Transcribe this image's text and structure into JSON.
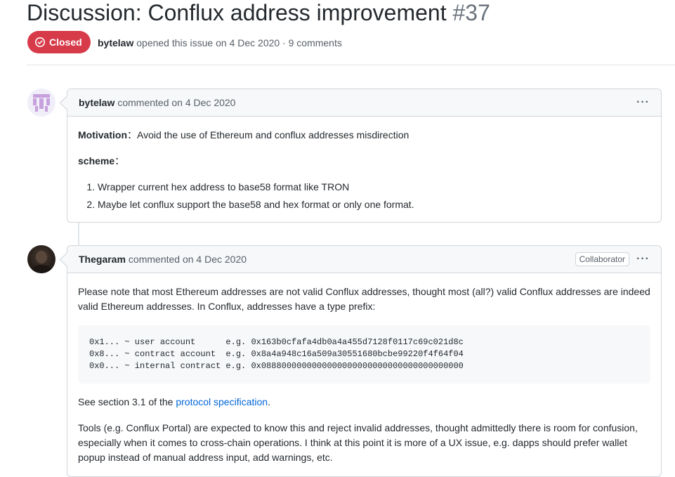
{
  "issue": {
    "title": "Discussion: Conflux address improvement",
    "number": "#37",
    "state": "Closed",
    "state_color": "#d73a49",
    "author": "bytelaw",
    "meta_text": "opened this issue on 4 Dec 2020 · 9 comments"
  },
  "comments": [
    {
      "author": "bytelaw",
      "when": "commented on 4 Dec 2020",
      "avatar_icon": "identicon-avatar",
      "motivation_label": "Motivation",
      "motivation_text": "：Avoid the use of Ethereum and conflux addresses misdirection",
      "scheme_label": "scheme",
      "scheme_suffix": "：",
      "list": [
        "Wrapper current hex address to base58 format like TRON",
        "Maybe let conflux support the base58 and hex format or only one format."
      ],
      "menu_icon": "kebab-menu-icon"
    },
    {
      "author": "Thegaram",
      "when": "commented on 4 Dec 2020",
      "badge": "Collaborator",
      "avatar_icon": "user-photo-avatar",
      "para1": "Please note that most Ethereum addresses are not valid Conflux addresses, thought most (all?) valid Conflux addresses are indeed valid Ethereum addresses. In Conflux, addresses have a type prefix:",
      "code_lines": [
        "0x1... ~ user account      e.g. 0x163b0cfafa4db0a4a455d7128f0117c69c021d8c",
        "0x8... ~ contract account  e.g. 0x8a4a948c16a509a30551680bcbe99220f4f64f04",
        "0x0... ~ internal contract e.g. 0x0888000000000000000000000000000000000000"
      ],
      "para2_before": "See section 3.1 of the ",
      "para2_link": "protocol specification",
      "para2_after": ".",
      "para3": "Tools (e.g. Conflux Portal) are expected to know this and reject invalid addresses, thought admittedly there is room for confusion, especially when it comes to cross-chain operations. I think at this point it is more of a UX issue, e.g. dapps should prefer wallet popup instead of manual address input, add warnings, etc.",
      "menu_icon": "kebab-menu-icon"
    }
  ]
}
